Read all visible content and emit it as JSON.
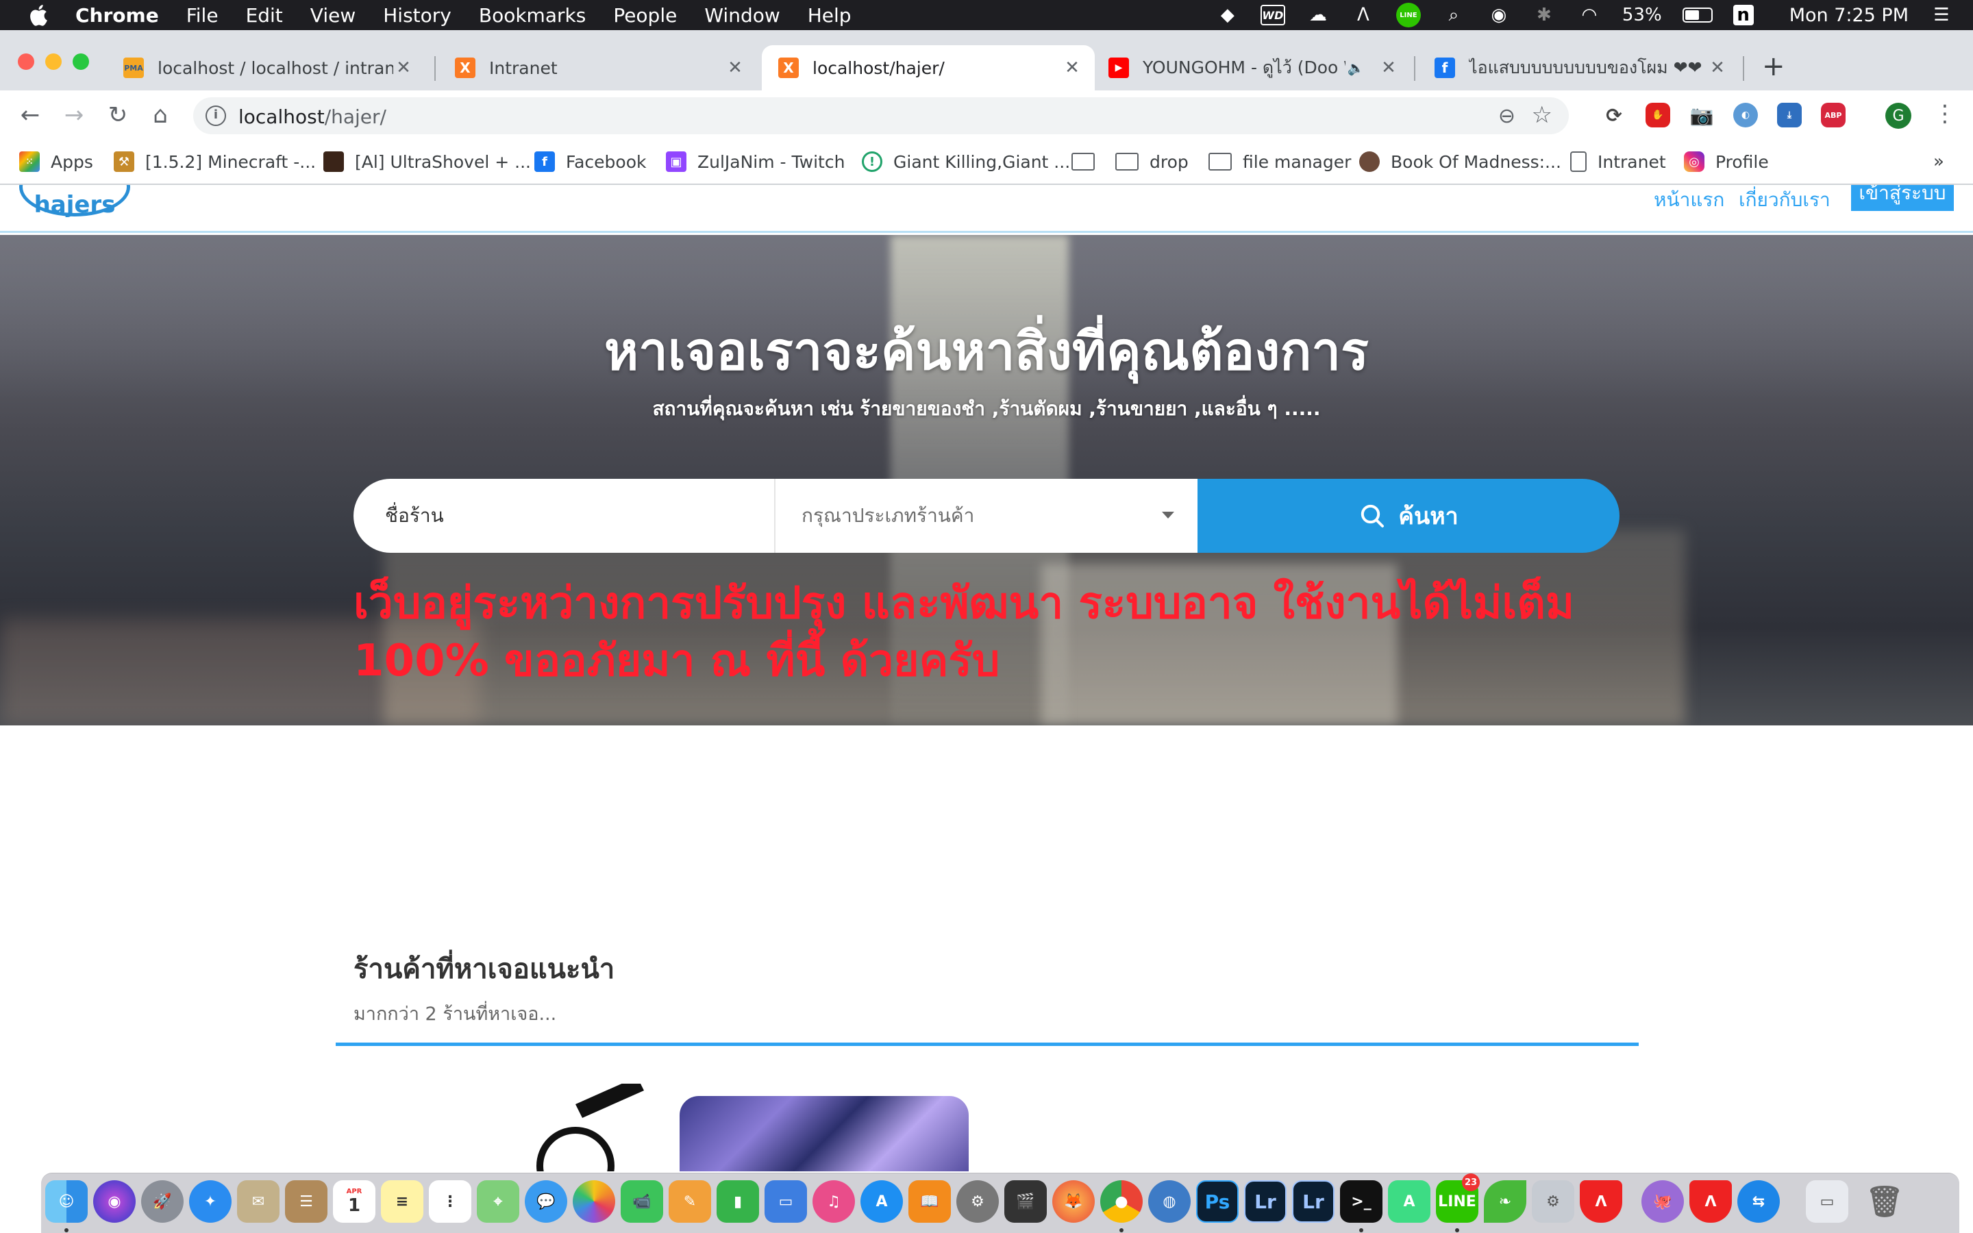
{
  "menubar": {
    "app": "Chrome",
    "items": [
      "File",
      "Edit",
      "View",
      "History",
      "Bookmarks",
      "People",
      "Window",
      "Help"
    ],
    "battery": "53%",
    "clock": "Mon 7:25 PM",
    "status_text_wd": "WD",
    "status_line": "LINE"
  },
  "tabs": [
    {
      "title": "localhost / localhost / intranet /",
      "icon": "phpmyadmin-icon",
      "fav_text": "PMA"
    },
    {
      "title": "Intranet",
      "icon": "xampp-icon",
      "fav_text": "X"
    },
    {
      "title": "localhost/hajer/",
      "icon": "xampp-icon",
      "fav_text": "X",
      "active": true
    },
    {
      "title": "YOUNGOHM - ดูไว้ (Doo Wi",
      "icon": "youtube-icon",
      "fav_text": "▶"
    },
    {
      "title": "ไอแสบบบบบบบบบของโผม ❤❤ ส่",
      "icon": "facebook-icon",
      "fav_text": "f"
    }
  ],
  "toolbar": {
    "url_host": "localhost",
    "url_path": "/hajer/",
    "avatar_letter": "G",
    "abp": "ABP"
  },
  "bookmarks": [
    {
      "label": "Apps",
      "icon": "apps-grid-icon"
    },
    {
      "label": "[1.5.2] Minecraft -...",
      "icon": "minecraft-icon"
    },
    {
      "label": "[Al] UltraShovel + ...",
      "icon": "game-icon"
    },
    {
      "label": "Facebook",
      "icon": "facebook-icon"
    },
    {
      "label": "ZulJaNim - Twitch",
      "icon": "twitch-icon"
    },
    {
      "label": "Giant Killing,Giant ...",
      "icon": "site-icon"
    },
    {
      "label": "",
      "icon": "folder-icon"
    },
    {
      "label": "drop",
      "icon": "folder-icon"
    },
    {
      "label": "file manager",
      "icon": "folder-icon"
    },
    {
      "label": "Book Of Madness:...",
      "icon": "avatar-icon"
    },
    {
      "label": "Intranet",
      "icon": "page-icon"
    },
    {
      "label": "Profile",
      "icon": "instagram-icon"
    }
  ],
  "site": {
    "logo_text": "hajers",
    "nav": [
      "หน้าแรก",
      "เกี่ยวกับเรา"
    ],
    "login": "เข้าสู่ระบบ",
    "hero_title": "หาเจอเราจะค้นหาสิ่งที่คุณต้องการ",
    "hero_subtitle": "สถานที่คุณจะค้นหา เช่น ร้ายขายของชำ ,ร้านตัดผม ,ร้านขายยา ,และอื่น ๆ .....",
    "search_placeholder": "ชื่อร้าน",
    "category_placeholder": "กรุณาประเภทร้านค้า",
    "search_button": "ค้นหา",
    "warning": "เว็บอยู่ระหว่างการปรับปรุง และพัฒนา ระบบอาจ ใช้งานได้ไม่เต็ม 100% ขออภัยมา ณ ที่นี้ ด้วยครับ",
    "section_title": "ร้านค้าที่หาเจอแนะนำ",
    "section_subtitle": "มากกว่า 2 ร้านที่หาเจอ..."
  },
  "dock": {
    "apps": [
      "finder",
      "siri",
      "launchpad",
      "safari",
      "mail",
      "contacts",
      "calendar",
      "notes",
      "reminders",
      "maps",
      "messages",
      "photos",
      "facetime",
      "pages",
      "numbers",
      "keynote",
      "itunes",
      "app-store",
      "ibooks",
      "system-preferences",
      "final-cut",
      "firefox",
      "chrome",
      "sequel-pro",
      "photoshop",
      "lightroom",
      "lightroom-classic",
      "terminal",
      "android-studio",
      "line",
      "leaf",
      "settings-utility",
      "adobe-acrobat",
      "github",
      "acrobat-2",
      "teamviewer",
      "finder-window",
      "trash"
    ],
    "line_badge": "23",
    "calendar_month": "APR",
    "calendar_day": "1",
    "ps": "Ps",
    "lr": "Lr"
  }
}
